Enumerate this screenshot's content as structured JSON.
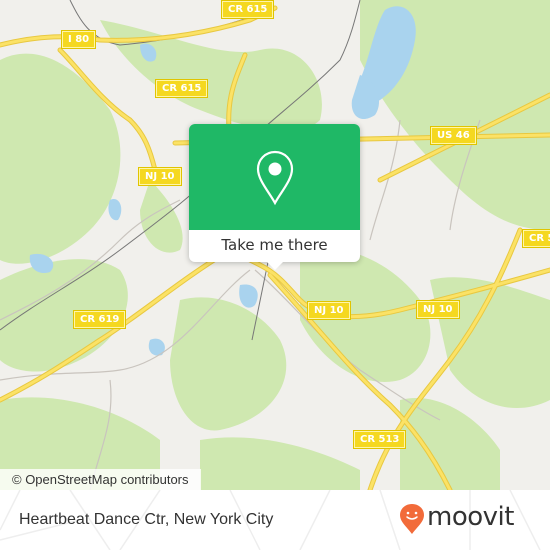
{
  "map": {
    "road_labels": [
      {
        "id": "i80",
        "text": "I 80"
      },
      {
        "id": "cr615-top",
        "text": "CR 615"
      },
      {
        "id": "cr615-mid",
        "text": "CR 615"
      },
      {
        "id": "us46",
        "text": "US 46"
      },
      {
        "id": "nj10-left",
        "text": "NJ 10"
      },
      {
        "id": "cr5-right",
        "text": "CR 5"
      },
      {
        "id": "cr619",
        "text": "CR 619"
      },
      {
        "id": "nj10-center",
        "text": "NJ 10"
      },
      {
        "id": "nj10-right",
        "text": "NJ 10"
      },
      {
        "id": "cr513",
        "text": "CR 513"
      }
    ],
    "attribution": "© OpenStreetMap contributors",
    "colors": {
      "land": "#f1f0ec",
      "forest": "#cfe8b0",
      "water": "#a9d3ee",
      "road": "#f5d820"
    }
  },
  "popup": {
    "icon": "map-pin-icon",
    "button_label": "Take me there",
    "accent_color": "#1fb866"
  },
  "footer": {
    "place_name": "Heartbeat Dance Ctr, New York City",
    "brand": "moovit",
    "brand_color": "#f26b3a"
  }
}
